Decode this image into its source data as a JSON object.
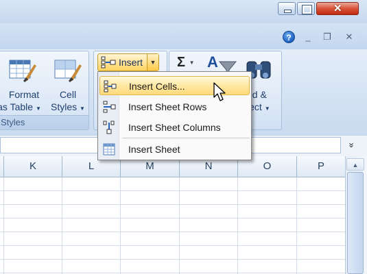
{
  "window": {
    "minimize_icon": "minimize-icon",
    "maximize_icon": "maximize-icon",
    "close_icon": "close-icon"
  },
  "ribbon_controls": {
    "help": "?",
    "minimize": "_",
    "restore": "❐",
    "close": "✕"
  },
  "groups": {
    "styles": {
      "label": "Styles",
      "format_as_table": {
        "line1": "Format",
        "line2": "as Table"
      },
      "cell_styles": {
        "line1": "Cell",
        "line2": "Styles"
      }
    },
    "cells": {
      "insert_label": "Insert"
    },
    "editing": {
      "sum_symbol": "Σ",
      "find_select": {
        "line1": "nd &",
        "line2": "lect"
      }
    }
  },
  "insert_menu": {
    "items": [
      {
        "label": "Insert Cells...",
        "icon": "insert-cells-icon",
        "highlighted": true
      },
      {
        "label": "Insert Sheet Rows",
        "icon": "insert-sheet-rows-icon",
        "highlighted": false
      },
      {
        "label": "Insert Sheet Columns",
        "icon": "insert-sheet-columns-icon",
        "highlighted": false
      },
      {
        "label": "Insert Sheet",
        "icon": "insert-sheet-icon",
        "highlighted": false
      }
    ]
  },
  "formula_bar": {
    "expand_symbol": "»"
  },
  "columns": [
    "K",
    "L",
    "M",
    "N",
    "O",
    "P"
  ],
  "scroll": {
    "up_symbol": "▲"
  },
  "colors": {
    "highlight": "#ffe49b",
    "ribbon": "#d3e1f2",
    "accent_text": "#1e3f6f"
  }
}
